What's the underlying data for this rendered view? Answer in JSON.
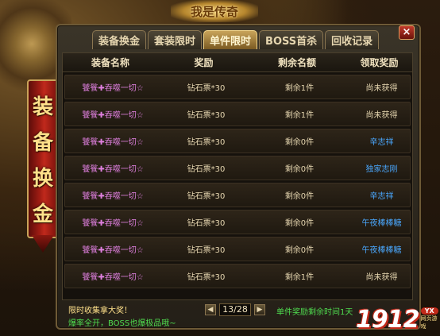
{
  "top_title": "我是传奇",
  "side_banner": [
    "装",
    "备",
    "换",
    "金"
  ],
  "tabs": [
    {
      "label": "装备换金",
      "active": false
    },
    {
      "label": "套装限时",
      "active": false
    },
    {
      "label": "单件限时",
      "active": true
    },
    {
      "label": "BOSS首杀",
      "active": false
    },
    {
      "label": "回收记录",
      "active": false
    }
  ],
  "close_label": "×",
  "table": {
    "headers": [
      "装备名称",
      "奖励",
      "剩余名额",
      "领取奖励"
    ],
    "rows": [
      {
        "name": "饕餮✚吞噬一切☆",
        "reward": "钻石票*30",
        "remaining": "剩余1件",
        "status": "尚未获得",
        "claimed": false
      },
      {
        "name": "饕餮✚吞噬一切☆",
        "reward": "钻石票*30",
        "remaining": "剩余1件",
        "status": "尚未获得",
        "claimed": false
      },
      {
        "name": "饕餮✚吞噬一切☆",
        "reward": "钻石票*30",
        "remaining": "剩余0件",
        "status": "辛志祥",
        "claimed": true
      },
      {
        "name": "饕餮✚吞噬一切☆",
        "reward": "钻石票*30",
        "remaining": "剩余0件",
        "status": "独家志刚",
        "claimed": true
      },
      {
        "name": "饕餮✚吞噬一切☆",
        "reward": "钻石票*30",
        "remaining": "剩余0件",
        "status": "辛志祥",
        "claimed": true
      },
      {
        "name": "饕餮✚吞噬一切☆",
        "reward": "钻石票*30",
        "remaining": "剩余0件",
        "status": "午夜棒棒糖",
        "claimed": true
      },
      {
        "name": "饕餮✚吞噬一切☆",
        "reward": "钻石票*30",
        "remaining": "剩余0件",
        "status": "午夜棒棒糖",
        "claimed": true
      },
      {
        "name": "饕餮✚吞噬一切☆",
        "reward": "钻石票*30",
        "remaining": "剩余1件",
        "status": "尚未获得",
        "claimed": false
      }
    ]
  },
  "footer": {
    "note1": "限时收集拿大奖！",
    "note2": "爆率全开，BOSS也爆极品哦~",
    "pager": {
      "prev": "◀",
      "page": "13/28",
      "next": "▶"
    },
    "timer": "单件奖励剩余时间1天"
  },
  "logo": {
    "number": "1912",
    "badge": "YX",
    "sub": "网页游戏"
  },
  "colors": {
    "item_name": "#e080e0",
    "claimed_player": "#4aa8ff",
    "green_text": "#4fdc4f",
    "gold_text": "#ffe08a"
  }
}
